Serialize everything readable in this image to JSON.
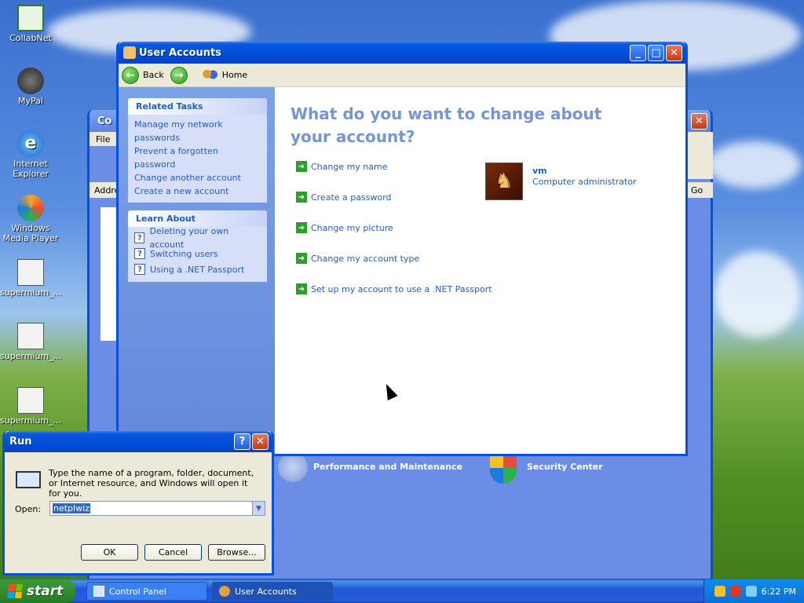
{
  "desktop": {
    "icons": [
      {
        "label": "CollabNet"
      },
      {
        "label": "MyPal"
      },
      {
        "label": "Internet Explorer"
      },
      {
        "label": "Windows Media Player"
      },
      {
        "label": "supermium_..."
      },
      {
        "label": "supermium_..."
      },
      {
        "label": "supermium_..."
      }
    ]
  },
  "control_panel_window": {
    "title": "Co",
    "menu_first": "File",
    "address_label": "Addre",
    "go_label": "Go",
    "categories": [
      "Performance and Maintenance",
      "Security Center"
    ]
  },
  "user_accounts": {
    "title": "User Accounts",
    "toolbar": {
      "back": "Back",
      "home": "Home"
    },
    "related_tasks": {
      "heading": "Related Tasks",
      "items": [
        "Manage my network passwords",
        "Prevent a forgotten password",
        "Change another account",
        "Create a new account"
      ]
    },
    "learn_about": {
      "heading": "Learn About",
      "items": [
        "Deleting your own account",
        "Switching users",
        "Using a .NET Passport"
      ]
    },
    "question": "What do you want to change about your account?",
    "options": [
      "Change my name",
      "Create a password",
      "Change my picture",
      "Change my account type",
      "Set up my account to use a .NET Passport"
    ],
    "account": {
      "name": "vm",
      "type": "Computer administrator"
    }
  },
  "run_dialog": {
    "title": "Run",
    "description": "Type the name of a program, folder, document, or Internet resource, and Windows will open it for you.",
    "open_label": "Open:",
    "open_value": "netplwiz",
    "ok": "OK",
    "cancel": "Cancel",
    "browse": "Browse..."
  },
  "taskbar": {
    "start": "start",
    "buttons": [
      "Control Panel",
      "User Accounts"
    ],
    "clock": "6:22 PM"
  }
}
